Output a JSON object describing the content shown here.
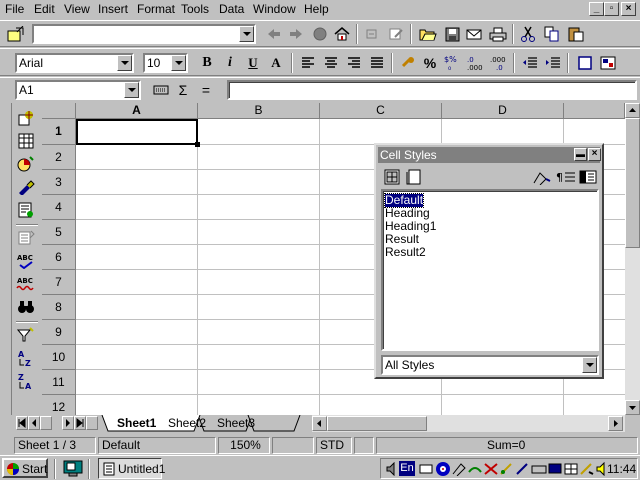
{
  "menu": [
    "File",
    "Edit",
    "View",
    "Insert",
    "Format",
    "Tools",
    "Data",
    "Window",
    "Help"
  ],
  "font_name": "Arial",
  "font_size": "10",
  "name_box": "A1",
  "formula_value": "",
  "columns": [
    "A",
    "B",
    "C",
    "D"
  ],
  "rows": [
    "1",
    "2",
    "3",
    "4",
    "5",
    "6",
    "7",
    "8",
    "9",
    "10",
    "11",
    "12"
  ],
  "sheet_tabs": [
    "Sheet1",
    "Sheet2",
    "Sheet3"
  ],
  "active_sheet": "Sheet1",
  "toolbar_glyphs": {
    "bold": "B",
    "italic": "i",
    "underline": "U",
    "font_color": "A",
    "currency": "%",
    "percent": "%",
    "add_decimal": ".000",
    "delete_decimal": ".000",
    "sum": "Σ",
    "equals": "=",
    "autocorrect": "ABC",
    "spellcheck": "ABC"
  },
  "cell_styles": {
    "title": "Cell Styles",
    "items": [
      "Default",
      "Heading",
      "Heading1",
      "Result",
      "Result2"
    ],
    "selected": "Default",
    "filter": "All Styles"
  },
  "status": {
    "sheet": "Sheet 1 / 3",
    "page_style": "Default",
    "zoom": "150%",
    "mode": "STD",
    "sum": "Sum=0"
  },
  "taskbar": {
    "start": "Start",
    "task": "Untitled1",
    "lang": "En",
    "clock": "11:44"
  },
  "colors": {
    "face": "#c0c0c0",
    "title_inactive": "#808080",
    "selection": "#000080"
  }
}
